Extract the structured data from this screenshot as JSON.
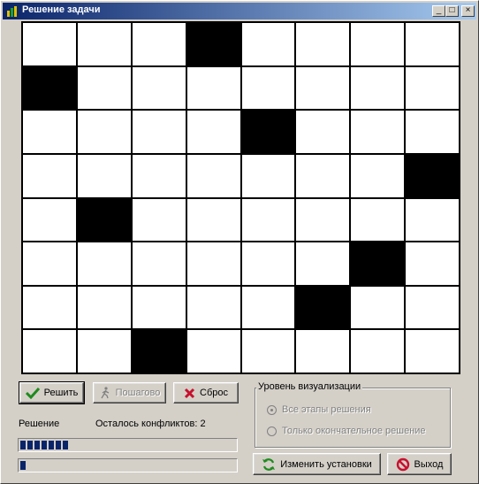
{
  "window": {
    "title": "Решение задачи",
    "minimize": "_",
    "maximize": "□",
    "close": "×"
  },
  "board": {
    "size": 8,
    "queens": [
      [
        0,
        3
      ],
      [
        1,
        0
      ],
      [
        2,
        4
      ],
      [
        3,
        7
      ],
      [
        4,
        1
      ],
      [
        5,
        6
      ],
      [
        6,
        5
      ],
      [
        7,
        2
      ]
    ]
  },
  "buttons": {
    "solve": "Решить",
    "step": "Пошагово",
    "reset": "Сброс",
    "change_settings": "Изменить установки",
    "exit": "Выход"
  },
  "visualization": {
    "title": "Уровень визуализации",
    "options": [
      {
        "label": "Все этапы решения",
        "selected": true
      },
      {
        "label": "Только окончательное решение",
        "selected": false
      }
    ]
  },
  "status": {
    "label": "Решение",
    "conflicts_label": "Осталось конфликтов: 2"
  },
  "progress": {
    "bar1_fraction": 0.22,
    "bar2_fraction": 0.03
  },
  "colors": {
    "title_start": "#0a246a",
    "title_end": "#a6caf0",
    "accent_green": "#1e8a1e",
    "accent_red": "#c8102e"
  }
}
